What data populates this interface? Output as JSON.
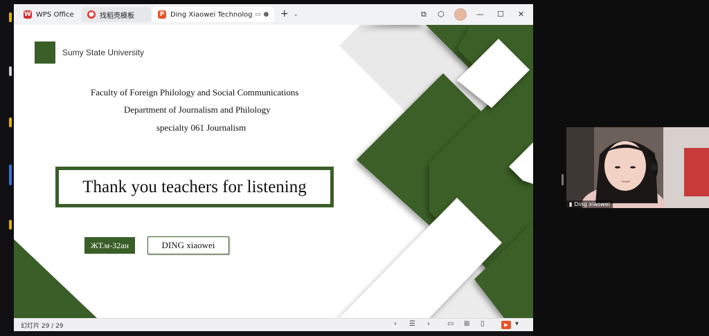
{
  "browser": {
    "tabs": [
      {
        "label": "WPS Office",
        "icon": "wps-logo-icon"
      },
      {
        "label": "找稻壳模板",
        "icon": "docer-logo-icon"
      },
      {
        "label": "Ding Xiaowei Technologies",
        "icon": "presentation-file-icon"
      }
    ],
    "new_tab": "+",
    "toolbar_icons": [
      "screen-share-icon",
      "cube-icon",
      "user-avatar-icon",
      "minimize-icon",
      "maximize-icon",
      "close-icon"
    ]
  },
  "slide": {
    "university": "Sumy State University",
    "faculty_lines": [
      "Faculty of Foreign Philology and Social Communications",
      "Department of Journalism and Philology",
      "specialty 061 Journalism"
    ],
    "title": "Thank you teachers for listening",
    "group": "ЖТ.м-32ан",
    "student": "DING  xiaowei",
    "accent_color": "#3a5e28"
  },
  "statusbar": {
    "slide_counter": "幻灯片 29 / 29"
  },
  "video": {
    "participant_name": "Ding xiaowei"
  }
}
